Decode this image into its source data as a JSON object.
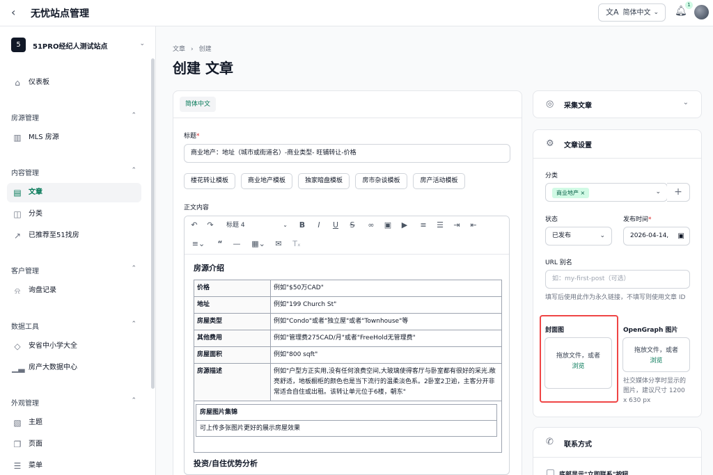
{
  "header": {
    "back_icon": "chevron-left-icon",
    "app_title": "无忧站点管理",
    "language": "简体中文",
    "language_icon": "translate-icon",
    "notification_count": "1"
  },
  "sidebar": {
    "site_initial": "5",
    "site_name": "51PRO经纪人测试站点",
    "dashboard": "仪表板",
    "groups": {
      "listings": "房源管理",
      "content": "内容管理",
      "customers": "客户管理",
      "data_tools": "数据工具",
      "appearance": "外观管理"
    },
    "items": {
      "mls": "MLS 房源",
      "articles": "文章",
      "categories": "分类",
      "recommended": "已推荐至51找房",
      "inquiries": "询盘记录",
      "schools": "安省中小学大全",
      "bigdata": "房产大数据中心",
      "themes": "主题",
      "pages": "页面",
      "menus": "菜单"
    }
  },
  "main": {
    "breadcrumb": [
      "文章",
      "创建"
    ],
    "page_title": "创建 文章",
    "lang_tab": "简体中文",
    "title_label": "标题",
    "title_value": "商业地产：地址（城市或街道名）-商业类型- 旺铺转让-价格",
    "templates": [
      "楼花转让模板",
      "商业地产模板",
      "独家暗盘模板",
      "房市杂谈模板",
      "房产活动模板"
    ],
    "body_label": "正文内容",
    "heading_select": "标题 4",
    "editor": {
      "section1": "房源介绍",
      "rows": [
        {
          "k": "价格",
          "v": "例如\"$50万CAD\""
        },
        {
          "k": "地址",
          "v": "例如\"199 Church St\""
        },
        {
          "k": "房屋类型",
          "v": "例如\"Condo\"或者\"独立屋\"或者\"Townhouse\"等"
        },
        {
          "k": "其他费用",
          "v": "例如\"管理费275CAD/月\"或者\"FreeHold无管理费\""
        },
        {
          "k": "房屋面积",
          "v": "例如\"800 sqft\""
        },
        {
          "k": "房源描述",
          "v": "例如\"户型方正实用,没有任何浪费空间,大玻璃使得客厅与卧室都有很好的采光.敞亮舒适，地板橱柜的颜色也是当下流行的温柔淡色系。2卧室2卫逾，主客分开非常适合自住或出租。该转让单元位于6楼，朝东\""
        }
      ],
      "gallery_title": "房屋图片集锦",
      "gallery_hint": "可上传多张图片更好的展示房屋效果",
      "section2": "投资/自住优势分析"
    }
  },
  "right": {
    "collect_title": "采集文章",
    "settings_title": "文章设置",
    "category_label": "分类",
    "category_tag": "商业地产",
    "status_label": "状态",
    "status_value": "已发布",
    "publish_label": "发布时间",
    "publish_value": "2026-04-14,",
    "url_label": "URL 别名",
    "url_placeholder": "如：my-first-post（可选）",
    "url_help": "填写后使用此作为永久链接，不填写则使用文章 ID",
    "cover_label": "封面图",
    "cover_drop": "拖放文件，或者",
    "cover_browse": "浏览",
    "og_label": "OpenGraph 图片",
    "og_drop": "拖放文件，或者",
    "og_browse": "浏览",
    "og_help": "社交媒体分享时显示的图片，建议尺寸 1200 x 630 px",
    "contact_title": "联系方式",
    "contact_checkbox": "底部显示\"立即联系\"按钮"
  },
  "colors": {
    "accent": "#047857",
    "highlight": "#ef4444"
  }
}
